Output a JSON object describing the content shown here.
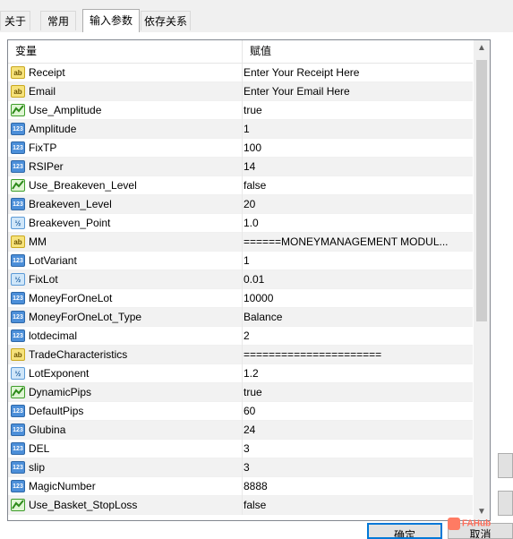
{
  "tabs": [
    {
      "label": "关于",
      "active": false
    },
    {
      "label": "常用",
      "active": false
    },
    {
      "label": "输入参数",
      "active": true
    },
    {
      "label": "依存关系",
      "active": false
    }
  ],
  "grid": {
    "header": {
      "variable": "变量",
      "value": "赋值"
    },
    "rows": [
      {
        "icon": "string-icon",
        "glyph": "ab",
        "name": "Receipt",
        "value": "Enter Your Receipt Here"
      },
      {
        "icon": "string-icon",
        "glyph": "ab",
        "name": "Email",
        "value": "Enter Your Email Here"
      },
      {
        "icon": "boolean-icon",
        "glyph": "",
        "name": "Use_Amplitude",
        "value": "true"
      },
      {
        "icon": "integer-icon",
        "glyph": "123",
        "name": "Amplitude",
        "value": "1"
      },
      {
        "icon": "integer-icon",
        "glyph": "123",
        "name": "FixTP",
        "value": "100"
      },
      {
        "icon": "integer-icon",
        "glyph": "123",
        "name": "RSIPer",
        "value": "14"
      },
      {
        "icon": "boolean-icon",
        "glyph": "",
        "name": "Use_Breakeven_Level",
        "value": "false"
      },
      {
        "icon": "integer-icon",
        "glyph": "123",
        "name": "Breakeven_Level",
        "value": "20"
      },
      {
        "icon": "double-icon",
        "glyph": "½",
        "name": "Breakeven_Point",
        "value": "1.0"
      },
      {
        "icon": "string-icon",
        "glyph": "ab",
        "name": "MM",
        "value": "======MONEYMANAGEMENT MODUL..."
      },
      {
        "icon": "integer-icon",
        "glyph": "123",
        "name": "LotVariant",
        "value": "1"
      },
      {
        "icon": "double-icon",
        "glyph": "½",
        "name": "FixLot",
        "value": "0.01"
      },
      {
        "icon": "integer-icon",
        "glyph": "123",
        "name": "MoneyForOneLot",
        "value": "10000"
      },
      {
        "icon": "integer-icon",
        "glyph": "123",
        "name": "MoneyForOneLot_Type",
        "value": "Balance"
      },
      {
        "icon": "integer-icon",
        "glyph": "123",
        "name": "lotdecimal",
        "value": "2"
      },
      {
        "icon": "string-icon",
        "glyph": "ab",
        "name": "TradeCharacteristics",
        "value": "======================"
      },
      {
        "icon": "double-icon",
        "glyph": "½",
        "name": "LotExponent",
        "value": "1.2"
      },
      {
        "icon": "boolean-icon",
        "glyph": "",
        "name": "DynamicPips",
        "value": "true"
      },
      {
        "icon": "integer-icon",
        "glyph": "123",
        "name": "DefaultPips",
        "value": "60"
      },
      {
        "icon": "integer-icon",
        "glyph": "123",
        "name": "Glubina",
        "value": "24"
      },
      {
        "icon": "integer-icon",
        "glyph": "123",
        "name": "DEL",
        "value": "3"
      },
      {
        "icon": "integer-icon",
        "glyph": "123",
        "name": "slip",
        "value": "3"
      },
      {
        "icon": "integer-icon",
        "glyph": "123",
        "name": "MagicNumber",
        "value": "8888"
      },
      {
        "icon": "boolean-icon",
        "glyph": "",
        "name": "Use_Basket_StopLoss",
        "value": "false"
      }
    ]
  },
  "scrollbar": {
    "up": "▲",
    "down": "▼"
  },
  "buttons": {
    "ok": "确定",
    "cancel": "取消"
  },
  "watermark": "FAHub"
}
